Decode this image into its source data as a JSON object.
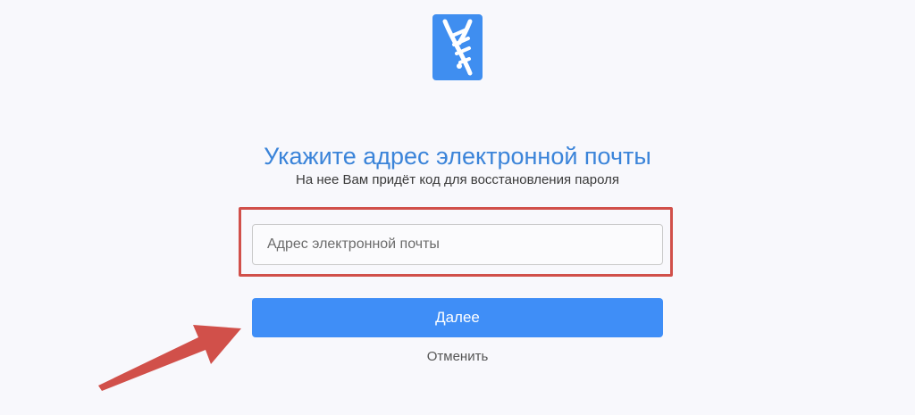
{
  "colors": {
    "background": "#f8f8fc",
    "accent": "#3f8ef7",
    "title": "#3b84d9",
    "highlight": "#d1504a"
  },
  "logo": {
    "icon": "brand-logo-icon"
  },
  "form": {
    "title": "Укажите адрес электронной почты",
    "subtitle": "На нее Вам придёт код для восстановления пароля",
    "email_placeholder": "Адрес электронной почты",
    "email_value": "",
    "next_label": "Далее",
    "cancel_label": "Отменить"
  },
  "annotations": {
    "highlight_box": "highlight-frame",
    "arrow": "arrow-pointer-icon"
  }
}
